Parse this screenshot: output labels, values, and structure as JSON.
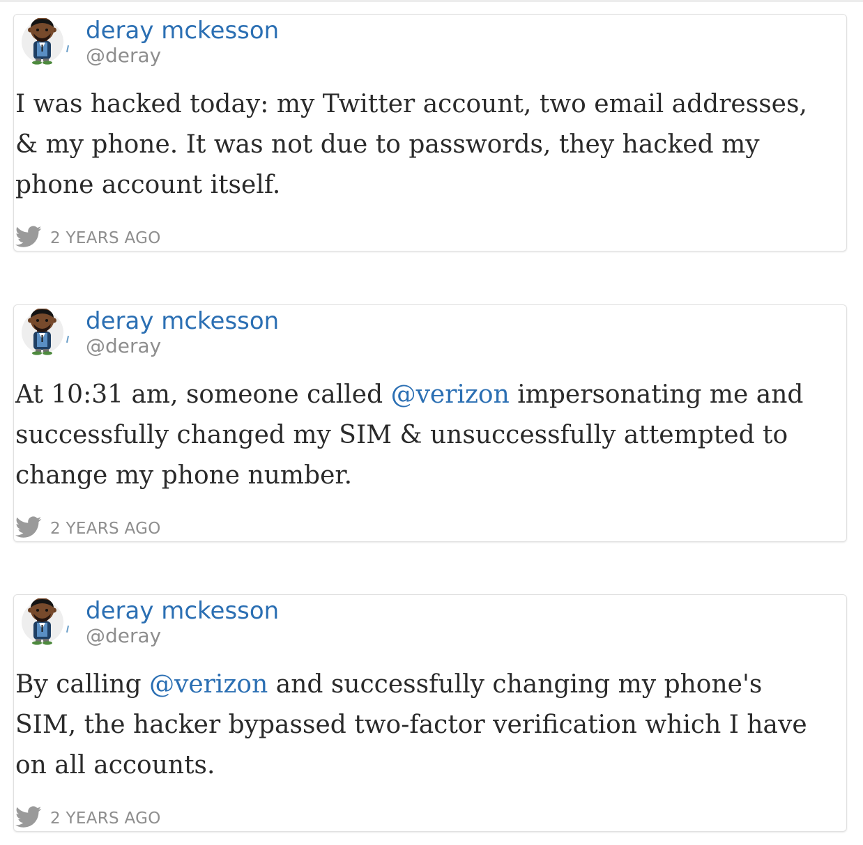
{
  "tweets": [
    {
      "author_name": "deray mckesson",
      "author_handle": "@deray",
      "text_lines": [
        [
          {
            "t": "I was hacked today: my Twitter account, two email addresses,"
          }
        ],
        [
          {
            "t": "& my phone. It was not due to passwords, they hacked my"
          }
        ],
        [
          {
            "t": "phone account itself."
          }
        ]
      ],
      "timestamp": "2 YEARS AGO",
      "icon": "twitter-bird-icon"
    },
    {
      "author_name": "deray mckesson",
      "author_handle": "@deray",
      "text_lines": [
        [
          {
            "t": "At 10:31 am, someone called "
          },
          {
            "t": "@verizon",
            "mention": true
          },
          {
            "t": " impersonating me and"
          }
        ],
        [
          {
            "t": "successfully changed my SIM & unsuccessfully attempted to"
          }
        ],
        [
          {
            "t": "change my phone number."
          }
        ]
      ],
      "timestamp": "2 YEARS AGO",
      "icon": "twitter-bird-icon"
    },
    {
      "author_name": "deray mckesson",
      "author_handle": "@deray",
      "text_lines": [
        [
          {
            "t": "By calling "
          },
          {
            "t": "@verizon",
            "mention": true
          },
          {
            "t": " and successfully changing my phone's"
          }
        ],
        [
          {
            "t": "SIM, the hacker bypassed two-factor verification which I have"
          }
        ],
        [
          {
            "t": "on all accounts."
          }
        ]
      ],
      "timestamp": "2 YEARS AGO",
      "icon": "twitter-bird-icon"
    }
  ],
  "colors": {
    "link": "#2b6fb3",
    "muted": "#8e8e8e",
    "body_text": "#2a2a2a",
    "border": "#e1e1e1",
    "bird_icon": "#9a9a9a"
  }
}
